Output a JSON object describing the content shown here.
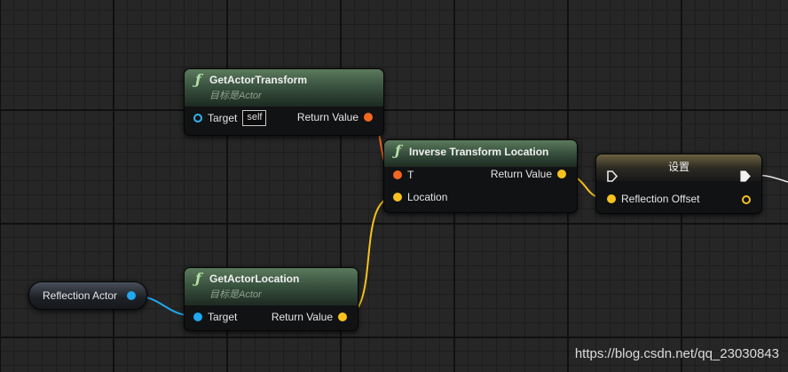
{
  "nodes": {
    "get_actor_transform": {
      "title": "GetActorTransform",
      "subtitle": "目标是Actor",
      "target_label": "Target",
      "self_label": "self",
      "return_label": "Return Value"
    },
    "inverse_transform_location": {
      "title": "Inverse Transform Location",
      "t_label": "T",
      "location_label": "Location",
      "return_label": "Return Value"
    },
    "set_node": {
      "title": "设置",
      "reflection_offset_label": "Reflection Offset"
    },
    "get_actor_location": {
      "title": "GetActorLocation",
      "subtitle": "目标是Actor",
      "target_label": "Target",
      "return_label": "Return Value"
    },
    "reflection_actor": {
      "label": "Reflection Actor"
    }
  },
  "watermark": "https://blog.csdn.net/qq_23030843",
  "colors": {
    "object_pin": "#1fa8ef",
    "transform_pin": "#f16820",
    "vector_pin": "#f7c21c",
    "function_header": "#3a5340",
    "set_header": "#6a6140"
  },
  "icons": {
    "function": "function-icon",
    "exec": "exec-pin-icon"
  }
}
